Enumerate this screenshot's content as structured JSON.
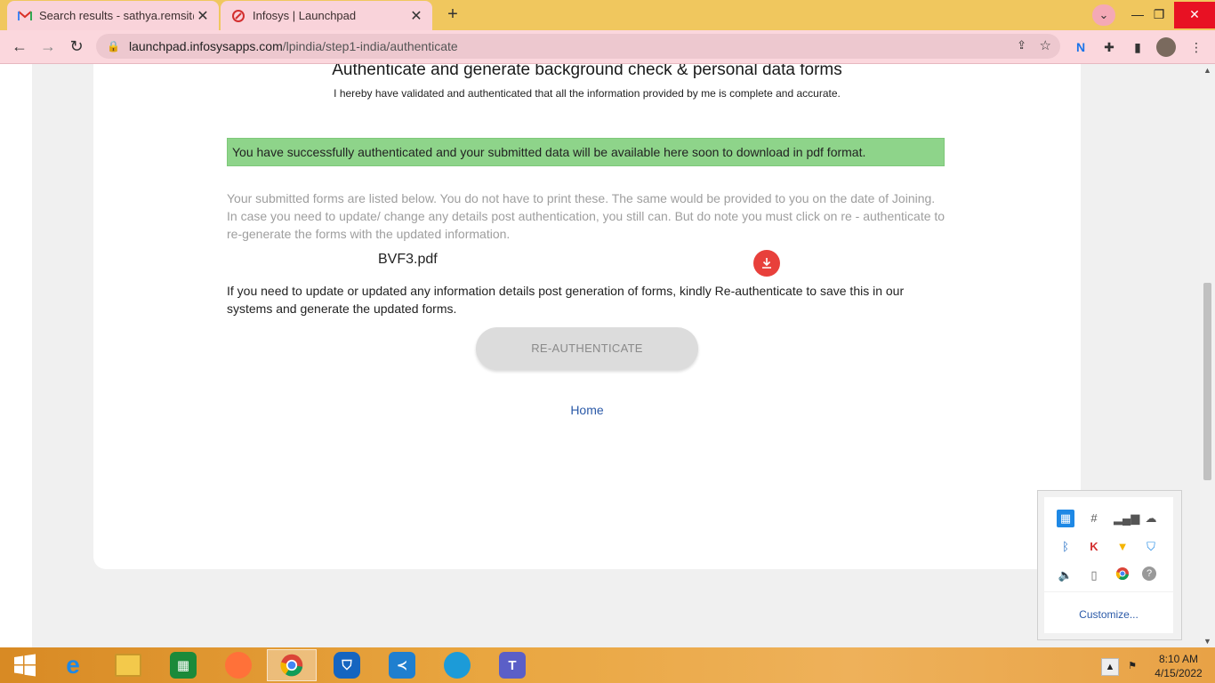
{
  "browser": {
    "tabs": [
      {
        "title": "Search results - sathya.remsit@g",
        "icon": "gmail-icon"
      },
      {
        "title": "Infosys | Launchpad",
        "icon": "launchpad-icon"
      }
    ],
    "url_host": "launchpad.infosysapps.com",
    "url_path": "/lpindia/step1-india/authenticate",
    "new_tab": "+",
    "back": "←",
    "forward": "→",
    "reload": "↻"
  },
  "page": {
    "title": "Authenticate and generate background check & personal data forms",
    "subtitle": "I hereby have validated and authenticated that all the information provided by me is complete and accurate.",
    "success_message": "You have successfully authenticated and your submitted data will be available here soon to download in pdf format.",
    "listed_text": "Your submitted forms are listed below. You do not have to print these. The same would be provided to you on the date of Joining. In case you need to update/ change any details post authentication, you still can. But do note you must click on re - authenticate to re-generate the forms with the updated information.",
    "file_name": "BVF3.pdf",
    "note_text": "If you need to update or updated any information details post generation of forms, kindly Re-authenticate to save this in our systems and generate the updated forms.",
    "reauth_button": "RE-AUTHENTICATE",
    "home_link": "Home"
  },
  "tray": {
    "customize": "Customize..."
  },
  "taskbar": {
    "time": "8:10 AM",
    "date": "4/15/2022"
  },
  "colors": {
    "success_bg": "#8ed48a",
    "download_btn": "#e8403b",
    "link": "#2b5aa8",
    "tabbar": "#f0c75e"
  }
}
